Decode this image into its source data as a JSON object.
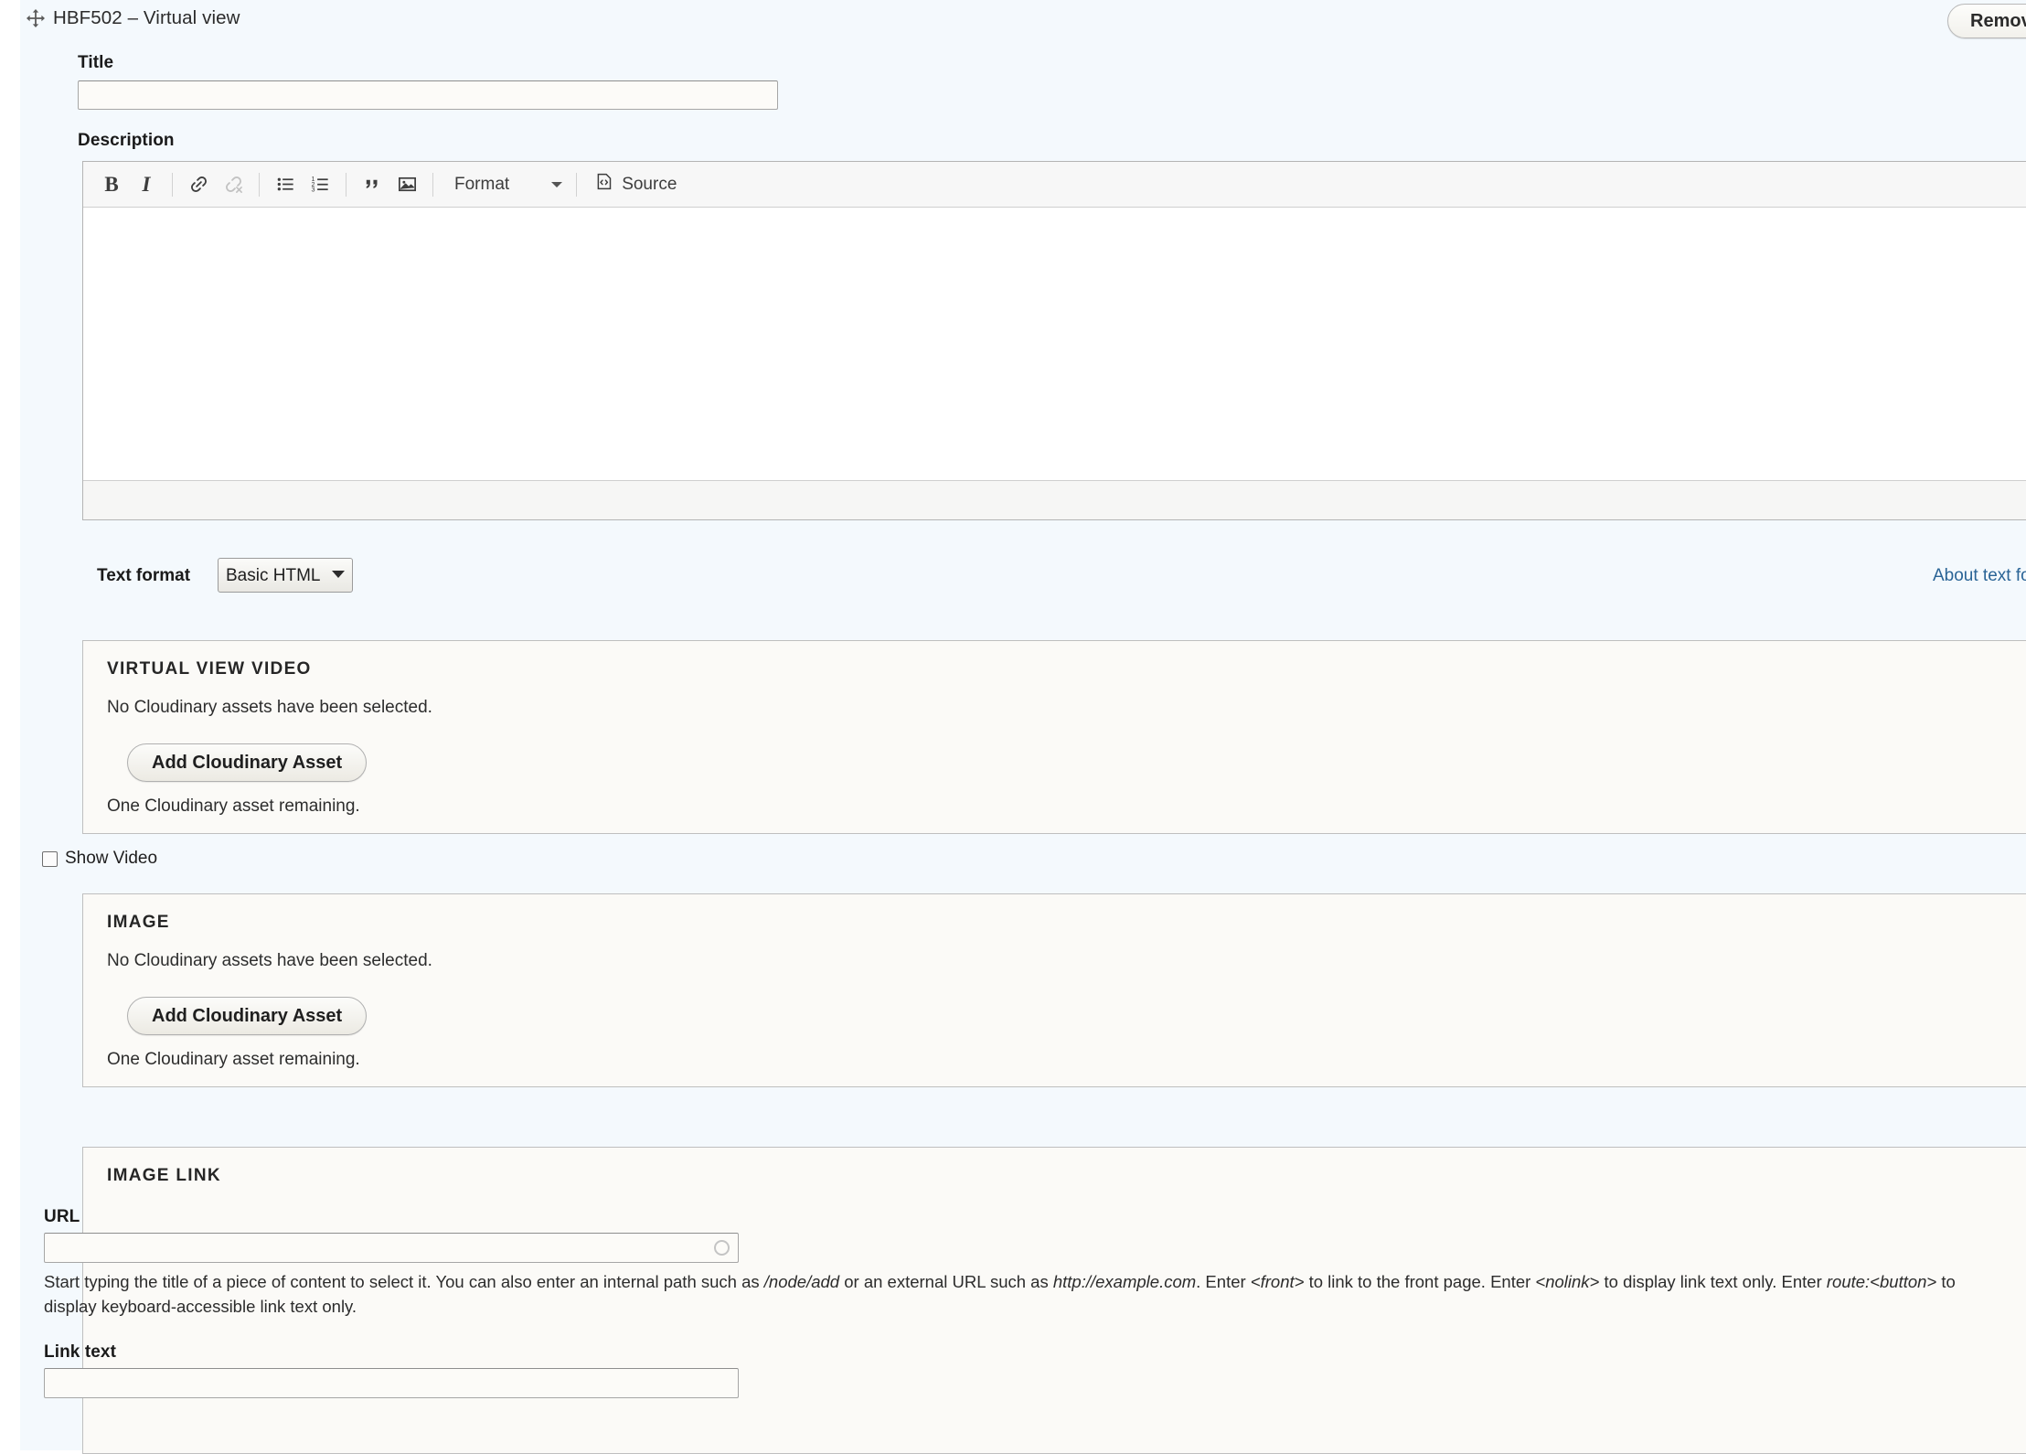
{
  "header": {
    "drag_icon": "move-cross-icon",
    "title": "HBF502 – Virtual view",
    "remove_label": "Remove"
  },
  "title_field": {
    "label": "Title",
    "value": "",
    "placeholder": ""
  },
  "description_field": {
    "label": "Description",
    "value": "",
    "toolbar": {
      "bold": "B",
      "italic": "I",
      "link_icon": "link-icon",
      "unlink_icon": "unlink-icon",
      "bulleted_list_icon": "bulleted-list-icon",
      "numbered_list_icon": "numbered-list-icon",
      "blockquote": "”",
      "image_icon": "image-icon",
      "format_label": "Format",
      "source_label": "Source"
    }
  },
  "text_format": {
    "label": "Text format",
    "selected": "Basic HTML",
    "options": [
      "Basic HTML"
    ],
    "about_link": "About text formats"
  },
  "virtual_view_video": {
    "legend": "VIRTUAL VIEW VIDEO",
    "no_assets_text": "No Cloudinary assets have been selected.",
    "add_button": "Add Cloudinary Asset",
    "remaining_text": "One Cloudinary asset remaining."
  },
  "show_video": {
    "label": "Show Video",
    "checked": false
  },
  "image": {
    "legend": "IMAGE",
    "no_assets_text": "No Cloudinary assets have been selected.",
    "add_button": "Add Cloudinary Asset",
    "remaining_text": "One Cloudinary asset remaining."
  },
  "image_link": {
    "legend": "IMAGE LINK",
    "url_label": "URL",
    "url_value": "",
    "url_description_parts": {
      "p1": "Start typing the title of a piece of content to select it. You can also enter an internal path such as ",
      "i1": "/node/add",
      "p2": " or an external URL such as ",
      "i2": "http://example.com",
      "p3": ". Enter ",
      "i3": "<front>",
      "p4": " to link to the front page. Enter ",
      "i4": "<nolink>",
      "p5": " to display link text only. Enter ",
      "i5": "route:<button>",
      "p6": " to display keyboard-accessible link text only."
    },
    "link_text_label": "Link text",
    "link_text_value": ""
  },
  "colors": {
    "page_background": "#f4f9fd",
    "fieldset_background": "#fbfaf7",
    "link_blue": "#2a6496",
    "text_dark": "#1a1a1a"
  }
}
